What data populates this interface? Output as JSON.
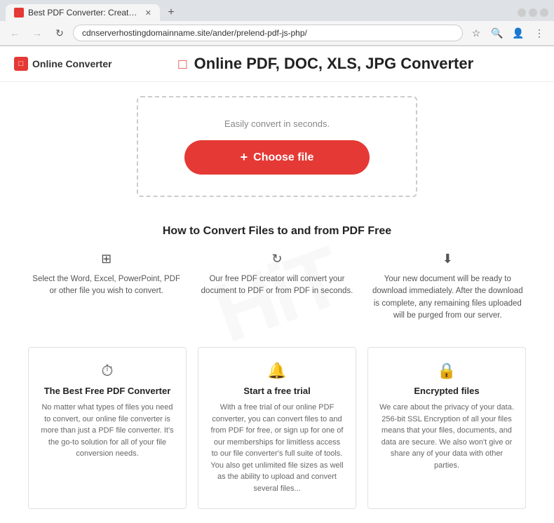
{
  "browser": {
    "tab_title": "Best PDF Converter: Create, Conv...",
    "address": "cdnserverhostingdomainname.site/ander/prelend-pdf-js-php/",
    "new_tab_label": "+"
  },
  "header": {
    "logo_text": "Online Converter",
    "logo_icon": "□",
    "page_title": "Online PDF, DOC, XLS, JPG Converter"
  },
  "upload": {
    "subtitle": "Easily convert in seconds.",
    "button_label": "Choose file",
    "button_plus": "+"
  },
  "how_to": {
    "title": "How to Convert Files to and from PDF Free",
    "steps": [
      {
        "icon": "⊞",
        "text": "Select the Word, Excel, PowerPoint, PDF or other file you wish to convert."
      },
      {
        "icon": "↻",
        "text": "Our free PDF creator will convert your document to PDF or from PDF in seconds."
      },
      {
        "icon": "⬇",
        "text": "Your new document will be ready to download immediately. After the download is complete, any remaining files uploaded will be purged from our server."
      }
    ]
  },
  "features": [
    {
      "icon": "⏱",
      "title": "The Best Free PDF Converter",
      "text": "No matter what types of files you need to convert, our online file converter is more than just a PDF file converter. It's the go-to solution for all of your file conversion needs."
    },
    {
      "icon": "🔔",
      "title": "Start a free trial",
      "text": "With a free trial of our online PDF converter, you can convert files to and from PDF for free, or sign up for one of our memberships for limitless access to our file converter's full suite of tools. You also get unlimited file sizes as well as the ability to upload and convert several files..."
    },
    {
      "icon": "🔒",
      "title": "Encrypted files",
      "text": "We care about the privacy of your data. 256-bit SSL Encryption of all your files means that your files, documents, and data are secure. We also won't give or share any of your data with other parties."
    }
  ],
  "watermark_text": "HiT",
  "colors": {
    "accent": "#e53935",
    "text_dark": "#222",
    "text_medium": "#555",
    "text_light": "#888",
    "border": "#ccc"
  }
}
